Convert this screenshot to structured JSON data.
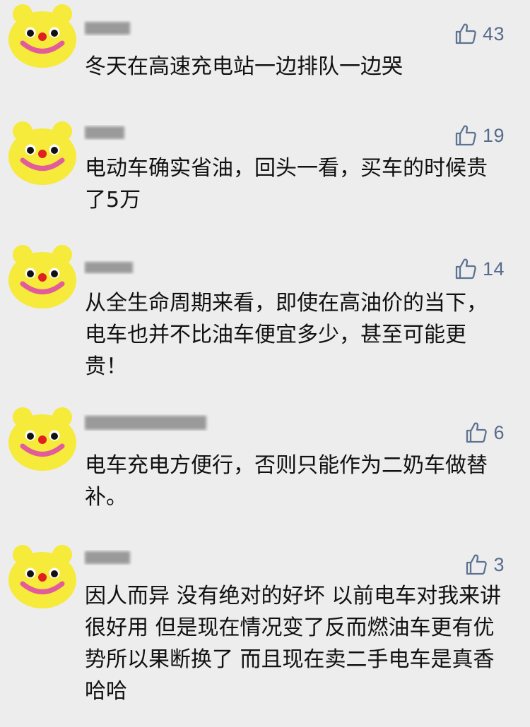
{
  "colors": {
    "background": "#ededed",
    "avatar_yellow": "#f6ea3a",
    "avatar_smile": "#e25c9c",
    "avatar_nose": "#e02020",
    "like_blue": "#576b8a",
    "text": "#111111"
  },
  "comments": [
    {
      "avatar_icon": "yellow-smiley-avatar-icon",
      "nickname": "",
      "likes": "43",
      "text": "冬天在高速充电站一边排队一边哭"
    },
    {
      "avatar_icon": "yellow-smiley-avatar-icon",
      "nickname": "",
      "likes": "19",
      "text": "电动车确实省油，回头一看，买车的时候贵了5万"
    },
    {
      "avatar_icon": "yellow-smiley-avatar-icon",
      "nickname": "",
      "likes": "14",
      "text": "从全生命周期来看，即使在高油价的当下，电车也并不比油车便宜多少，甚至可能更贵！"
    },
    {
      "avatar_icon": "yellow-smiley-avatar-icon",
      "nickname": "",
      "likes": "6",
      "text": "电车充电方便行，否则只能作为二奶车做替补。"
    },
    {
      "avatar_icon": "yellow-smiley-avatar-icon",
      "nickname": "",
      "likes": "3",
      "text": "因人而异 没有绝对的好坏 以前电车对我来讲很好用 但是现在情况变了反而燃油车更有优势所以果断换了 而且现在卖二手电车是真香 哈哈"
    }
  ]
}
